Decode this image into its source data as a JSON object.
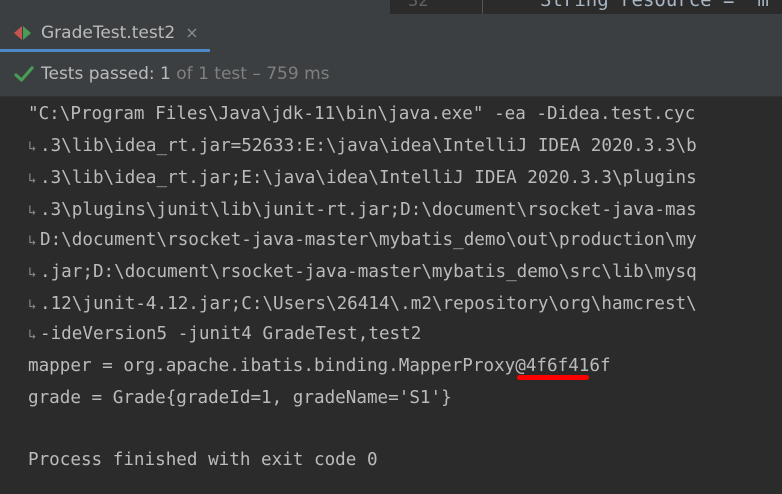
{
  "editor_peek": {
    "line_number": "32",
    "code": "String resource = \"m"
  },
  "tab": {
    "title": "GradeTest.test2",
    "close": "×"
  },
  "status": {
    "prefix": "Tests passed: ",
    "passed": "1",
    "suffix": " of 1 test – 759 ms"
  },
  "console": {
    "lines": [
      {
        "wrapped": false,
        "text": "\"C:\\Program Files\\Java\\jdk-11\\bin\\java.exe\" -ea -Didea.test.cyc"
      },
      {
        "wrapped": true,
        "text": ".3\\lib\\idea_rt.jar=52633:E:\\java\\idea\\IntelliJ IDEA 2020.3.3\\b"
      },
      {
        "wrapped": true,
        "text": ".3\\lib\\idea_rt.jar;E:\\java\\idea\\IntelliJ IDEA 2020.3.3\\plugins"
      },
      {
        "wrapped": true,
        "text": ".3\\plugins\\junit\\lib\\junit-rt.jar;D:\\document\\rsocket-java-mas"
      },
      {
        "wrapped": true,
        "text": "D:\\document\\rsocket-java-master\\mybatis_demo\\out\\production\\my"
      },
      {
        "wrapped": true,
        "text": ".jar;D:\\document\\rsocket-java-master\\mybatis_demo\\src\\lib\\mysq"
      },
      {
        "wrapped": true,
        "text": ".12\\junit-4.12.jar;C:\\Users\\26414\\.m2\\repository\\org\\hamcrest\\"
      },
      {
        "wrapped": true,
        "text": "-ideVersion5 -junit4 GradeTest,test2"
      },
      {
        "wrapped": false,
        "text": "mapper = org.apache.ibatis.binding.MapperProxy@4f6f416f"
      },
      {
        "wrapped": false,
        "text": "grade = Grade{gradeId=1, gradeName='S1'}"
      },
      {
        "wrapped": false,
        "text": ""
      },
      {
        "wrapped": false,
        "text": "Process finished with exit code 0"
      }
    ]
  },
  "colors": {
    "background": "#2b2b2b",
    "panel": "#3c3f41",
    "text": "#bbbbbb",
    "pass_green": "#499c54",
    "annotation_red": "#ff0000",
    "tab_underline": "#4a88c7"
  },
  "icons": {
    "run": "run-debug-icon",
    "check": "checkmark-icon",
    "close": "close-icon",
    "wrap": "soft-wrap-icon"
  }
}
